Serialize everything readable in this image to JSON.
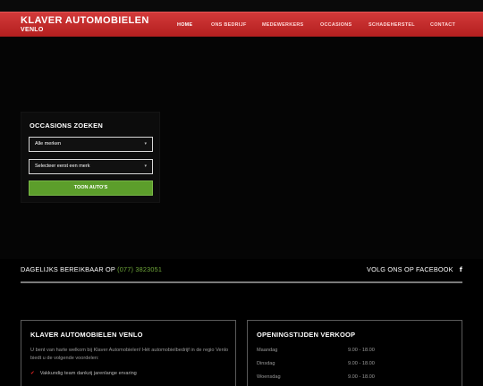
{
  "header": {
    "logo_main": "KLAVER AUTOMOBIELEN",
    "logo_sub": "VENLO",
    "nav": [
      "HOME",
      "ONS BEDRIJF",
      "MEDEWERKERS",
      "OCCASIONS",
      "SCHADEHERSTEL",
      "CONTACT"
    ]
  },
  "search": {
    "title": "OCCASIONS ZOEKEN",
    "brand_select": "Alle merken",
    "model_select": "Selecteer eerst een merk",
    "button": "TOON AUTO'S"
  },
  "contact": {
    "phone_label": "DAGELIJKS BEREIKBAAR OP ",
    "phone_number": "(077) 3823051",
    "facebook_label": "VOLG ONS OP FACEBOOK",
    "facebook_icon": "f"
  },
  "about": {
    "title": "KLAVER AUTOMOBIELEN VENLO",
    "intro": "U bent van harte welkom bij Klaver Automobielen! Hét automobielbedrijf in de regio Venlo biedt u de volgende voordelen:",
    "items": [
      "Vakkundig team dankzij jarenlange ervaring"
    ]
  },
  "hours": {
    "title": "OPENINGSTIJDEN VERKOOP",
    "rows": [
      {
        "day": "Maandag",
        "time": "9.00 - 18.00"
      },
      {
        "day": "Dinsdag",
        "time": "9.00 - 18.00"
      },
      {
        "day": "Woensdag",
        "time": "9.00 - 18.00"
      }
    ]
  },
  "colors": {
    "header_red": "#c62828",
    "accent_green": "#5c9e2b",
    "check_red": "#dd2222"
  }
}
